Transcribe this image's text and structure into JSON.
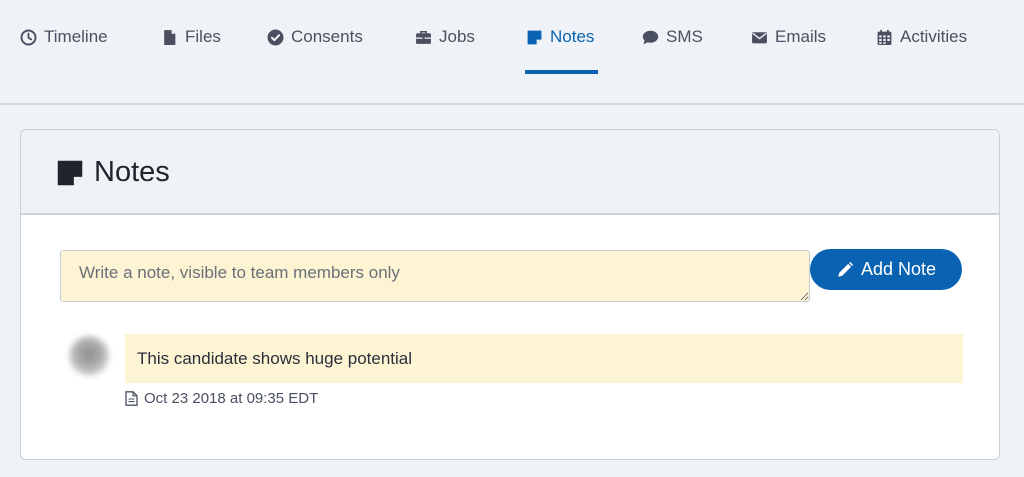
{
  "tabs": [
    {
      "id": "timeline",
      "label": "Timeline",
      "icon": "clock-icon",
      "active": false
    },
    {
      "id": "files",
      "label": "Files",
      "icon": "file-icon",
      "active": false
    },
    {
      "id": "consents",
      "label": "Consents",
      "icon": "check-circle-icon",
      "active": false
    },
    {
      "id": "jobs",
      "label": "Jobs",
      "icon": "briefcase-icon",
      "active": false
    },
    {
      "id": "notes",
      "label": "Notes",
      "icon": "sticky-note-icon",
      "active": true
    },
    {
      "id": "sms",
      "label": "SMS",
      "icon": "chat-bubble-icon",
      "active": false
    },
    {
      "id": "emails",
      "label": "Emails",
      "icon": "envelope-icon",
      "active": false
    },
    {
      "id": "activities",
      "label": "Activities",
      "icon": "calendar-icon",
      "active": false
    }
  ],
  "colors": {
    "accent": "#0a63b2",
    "note_background": "#fdf4d4",
    "page_background": "#eff2f6"
  },
  "notes_panel": {
    "title": "Notes",
    "title_icon": "sticky-note-icon",
    "input_placeholder": "Write a note, visible to team members only",
    "input_value": "",
    "add_button_label": "Add Note",
    "add_button_icon": "pencil-icon",
    "notes": [
      {
        "text": "This candidate shows huge potential",
        "timestamp": "Oct 23 2018 at 09:35 EDT",
        "timestamp_icon": "document-icon"
      }
    ]
  }
}
